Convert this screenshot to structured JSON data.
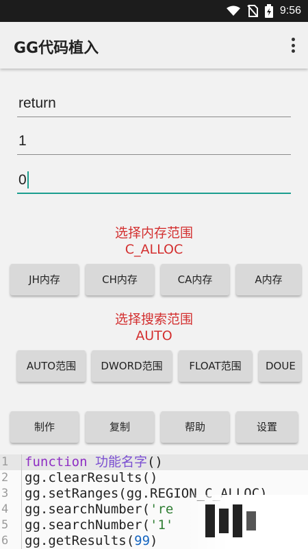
{
  "status_bar": {
    "time": "9:56"
  },
  "app_bar": {
    "title": "GG代码植入"
  },
  "fields": [
    "return",
    "1",
    "0"
  ],
  "memory": {
    "label": "选择内存范围",
    "value": "C_ALLOC",
    "buttons": [
      "JH内存",
      "CH内存",
      "CA内存",
      "A内存"
    ]
  },
  "search": {
    "label": "选择搜索范围",
    "value": "AUTO",
    "buttons": [
      "AUTO范围",
      "DWORD范围",
      "FLOAT范围",
      "DOUE"
    ]
  },
  "actions": [
    "制作",
    "复制",
    "帮助",
    "设置"
  ],
  "editor": {
    "line_numbers": [
      "1",
      "2",
      "3",
      "4",
      "5",
      "6"
    ],
    "lines": [
      [
        "function",
        " ",
        "功能名字",
        "()"
      ],
      [
        "gg.clearResults()"
      ],
      [
        "gg.setRanges(gg.REGION_C_ALLOC)"
      ],
      [
        "gg.searchNumber(",
        "'re"
      ],
      [
        "gg.searchNumber(",
        "'1'"
      ],
      [
        "gg.getResults(",
        "99",
        ")"
      ]
    ]
  },
  "colors": {
    "accent": "#1a9e8e",
    "label_red": "#d32f2f",
    "keyword": "#8e2fc4"
  }
}
